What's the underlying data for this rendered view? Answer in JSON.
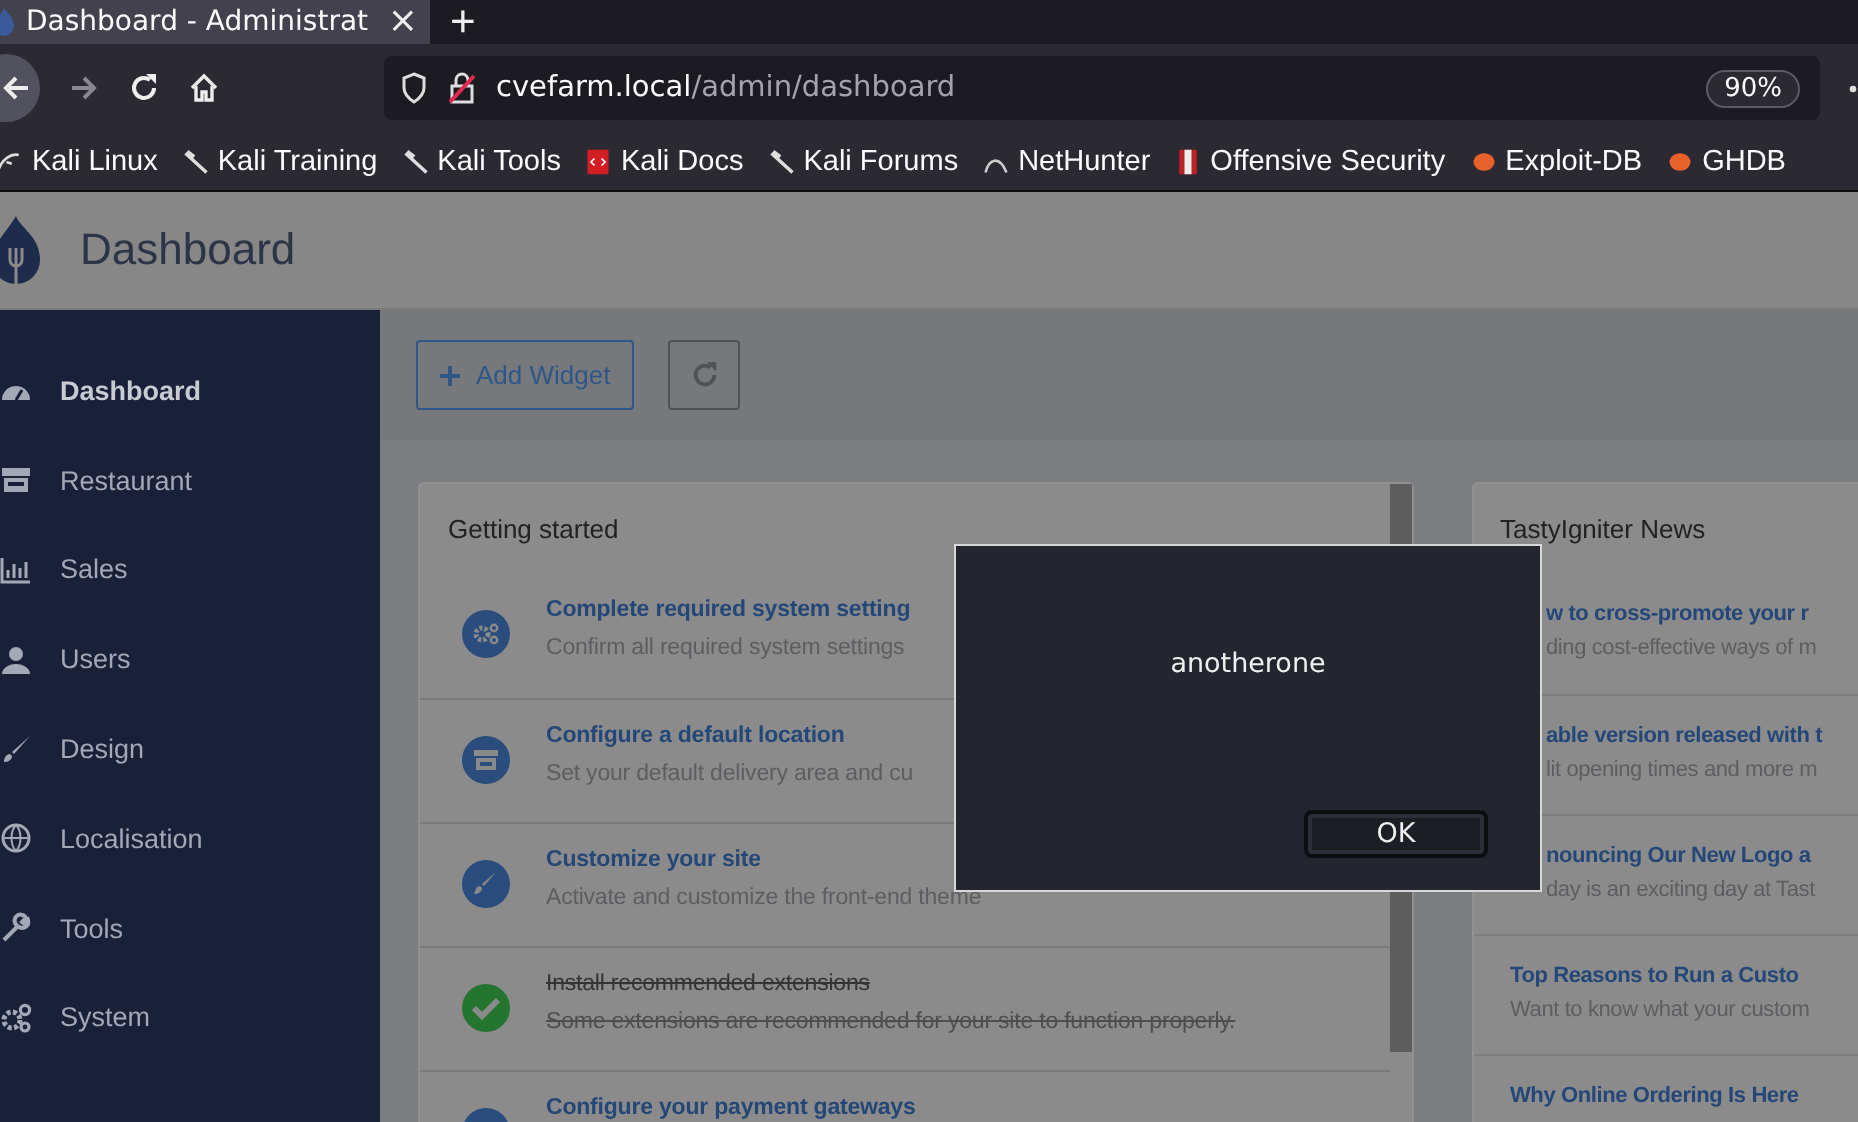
{
  "browser": {
    "tab": {
      "title": "Dashboard - Administrat",
      "close": "×"
    },
    "new_tab": "+",
    "address": {
      "host": "cvefarm.local",
      "path": "/admin/dashboard",
      "zoom": "90%"
    },
    "bookmarks": [
      "Kali Linux",
      "Kali Training",
      "Kali Tools",
      "Kali Docs",
      "Kali Forums",
      "NetHunter",
      "Offensive Security",
      "Exploit-DB",
      "GHDB"
    ]
  },
  "header": {
    "title": "Dashboard"
  },
  "sidebar": {
    "items": [
      {
        "label": "Dashboard",
        "selected": true
      },
      {
        "label": "Restaurant",
        "selected": false
      },
      {
        "label": "Sales",
        "selected": false
      },
      {
        "label": "Users",
        "selected": false
      },
      {
        "label": "Design",
        "selected": false
      },
      {
        "label": "Localisation",
        "selected": false
      },
      {
        "label": "Tools",
        "selected": false
      },
      {
        "label": "System",
        "selected": false
      }
    ]
  },
  "toolbar": {
    "add_widget": "Add Widget"
  },
  "getting_started": {
    "title": "Getting started",
    "items": [
      {
        "title": "Complete required system setting",
        "text": "Confirm all required system settings",
        "done": false
      },
      {
        "title": "Configure a default location",
        "text": "Set your default delivery area and cu",
        "done": false
      },
      {
        "title": "Customize your site",
        "text": "Activate and customize the front-end theme",
        "done": false
      },
      {
        "title": "Install recommended extensions",
        "text": "Some extensions are recommended for your site to function properly.",
        "done": true
      },
      {
        "title": "Configure your payment gateways",
        "done": false
      }
    ]
  },
  "news": {
    "title": "TastyIgniter News",
    "items": [
      {
        "kind": "cut",
        "title": "w to cross-promote your r",
        "text": "ding cost-effective ways of m"
      },
      {
        "kind": "cut",
        "title": "able version released with t",
        "text": "lit opening times and more m"
      },
      {
        "kind": "cut",
        "title": "nouncing Our New Logo a",
        "text": "day is an exciting day at Tast"
      },
      {
        "kind": "full",
        "title": "Top Reasons to Run a Custo",
        "text": "Want to know what your custom"
      },
      {
        "kind": "full",
        "title": "Why Online Ordering Is Here"
      }
    ]
  },
  "dialog": {
    "message": "anotherone",
    "button": "OK"
  }
}
